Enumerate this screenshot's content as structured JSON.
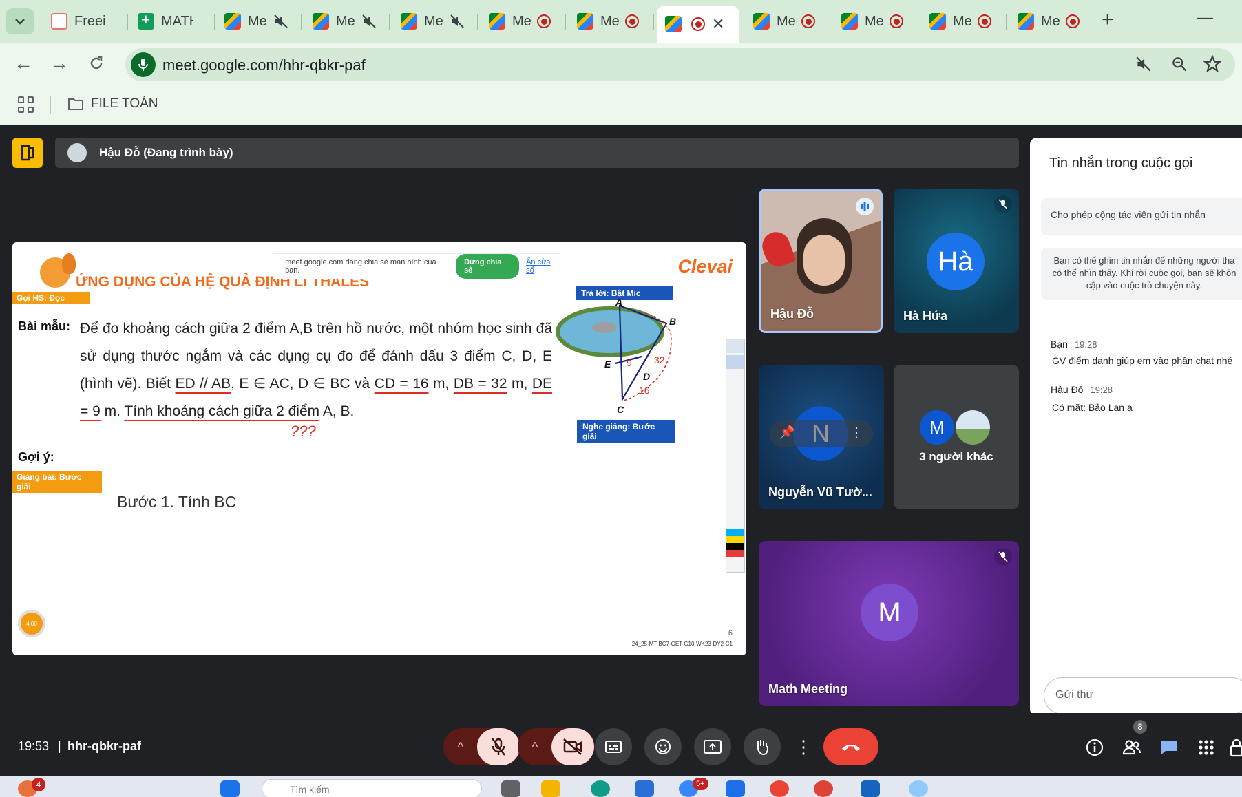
{
  "browser": {
    "tabs": [
      {
        "title": "Freeima",
        "favicon": "freeimage-icon",
        "status": "none"
      },
      {
        "title": "MATH_",
        "favicon": "sheets-icon",
        "status": "none"
      },
      {
        "title": "Me",
        "favicon": "meet-icon",
        "status": "muted"
      },
      {
        "title": "Me",
        "favicon": "meet-icon",
        "status": "muted"
      },
      {
        "title": "Me",
        "favicon": "meet-icon",
        "status": "muted"
      },
      {
        "title": "Me",
        "favicon": "meet-icon",
        "status": "recording"
      },
      {
        "title": "Me",
        "favicon": "meet-icon",
        "status": "recording"
      },
      {
        "title": "",
        "favicon": "meet-icon",
        "status": "recording-active"
      },
      {
        "title": "Me",
        "favicon": "meet-icon",
        "status": "recording"
      },
      {
        "title": "Me",
        "favicon": "meet-icon",
        "status": "recording"
      },
      {
        "title": "Me",
        "favicon": "meet-icon",
        "status": "recording"
      },
      {
        "title": "Me",
        "favicon": "meet-icon",
        "status": "recording"
      }
    ],
    "url": "meet.google.com/hhr-qbkr-paf",
    "bookmark_folder": "FILE TOÁN"
  },
  "meet": {
    "presenter_label": "Hậu Đỗ (Đang trình bày)",
    "slide": {
      "share_notice": "meet.google.com đang chia sẻ màn hình của bạn.",
      "share_stop": "Dừng chia sẻ",
      "share_hide": "Ẩn cửa sổ",
      "title": "ỨNG DỤNG CỦA HỆ QUẢ ĐỊNH LÍ THALES",
      "brand": "Clevai",
      "tag_call_student": "Gọi HS: Đọc",
      "label_sample": "Bài mẫu:",
      "problem_part1": "Để đo khoảng cách giữa 2 điểm A,B trên hồ nước, một nhóm học sinh đã sử dụng thước ngắm và các dụng cụ đo để đánh dấu 3 điểm C, D, E (hình vẽ). Biết ",
      "problem_u1": "ED // AB",
      "problem_part2": ", E ∈ AC, D ∈ BC và ",
      "problem_u2": "CD = 16",
      "problem_part3": " m, ",
      "problem_u3": "DB = 32",
      "problem_part4": " m, ",
      "problem_u4": "DE = 9",
      "problem_part5": " m. ",
      "problem_u5": "Tính khoảng cách giữa 2 điểm",
      "problem_part6": " A, B.",
      "question_marks": "???",
      "label_hint": "Gợi ý:",
      "tag_lecture": "Giảng bài: Bước giải",
      "step1": "Bước 1. Tính BC",
      "tag_answer": "Trả lời: Bật Mic",
      "tag_listen": "Nghe giảng: Bước giải",
      "figure_points": [
        "A",
        "B",
        "C",
        "D",
        "E"
      ],
      "figure_numbers": [
        "9",
        "32",
        "16"
      ],
      "timer": "4:00",
      "page": "6",
      "code": "24_25-MT-BC7-GET-G10-WK23-DY2-C1"
    },
    "participants": [
      {
        "name": "Hậu Đỗ",
        "type": "video",
        "speaking": true
      },
      {
        "name": "Hà Hứa",
        "initials": "Hà",
        "muted": true,
        "color": "#1a73e8"
      },
      {
        "name": "Nguyễn Vũ Tườ...",
        "initials": "N",
        "color": "#0b57d0"
      },
      {
        "name": "3 người khác",
        "initials": "M"
      },
      {
        "name": "Math Meeting",
        "initials": "M",
        "muted": true,
        "color": "#7c4dcc"
      }
    ],
    "chat": {
      "title": "Tin nhắn trong cuộc gọi",
      "allow_label": "Cho phép cộng tác viên gửi tin nhắn",
      "info": "Bạn có thể ghim tin nhắn để những người tha có thể nhìn thấy. Khi rời cuộc gọi, bạn sẽ khôn cập vào cuộc trò chuyện này.",
      "messages": [
        {
          "sender": "Bạn",
          "time": "19:28",
          "text": "GV điểm danh giúp em vào phần chat nhé"
        },
        {
          "sender": "Hậu Đỗ",
          "time": "19:28",
          "text": "Có mặt: Bảo Lan ạ"
        }
      ],
      "input_placeholder": "Gửi thư"
    },
    "bottom": {
      "time": "19:53",
      "code": "hhr-qbkr-paf",
      "people_count": "8"
    }
  },
  "taskbar": {
    "notification_count": "4",
    "search_placeholder": "Tìm kiếm",
    "badge": "5+"
  }
}
